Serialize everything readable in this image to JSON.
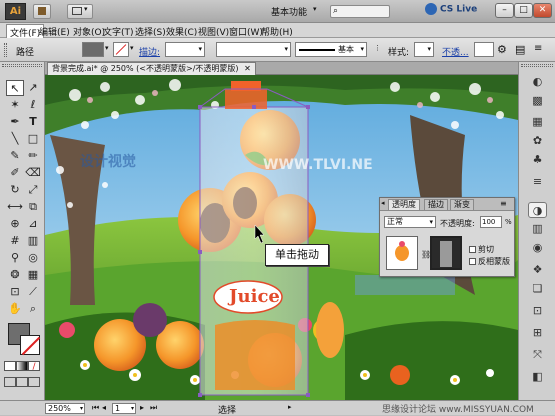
{
  "titlebar": {
    "app_logo": "Ai",
    "workspace": "基本功能",
    "cs_live": "CS Live",
    "win_buttons": [
      "minimize-icon",
      "maximize-icon",
      "close-icon"
    ]
  },
  "menu": [
    "文件(F)",
    "编辑(E)",
    "对象(O)",
    "文字(T)",
    "选择(S)",
    "效果(C)",
    "视图(V)",
    "窗口(W)",
    "帮助(H)"
  ],
  "control": {
    "selection_label": "路径",
    "stroke_label": "描边:",
    "style_preset": "基本",
    "style_label": "样式:",
    "opacity_link": "不透...",
    "opacity_value": ""
  },
  "document_tab": "背景完成.ai* @ 250% (<不透明蒙版>/不透明蒙版)",
  "tooltip": "单击拖动",
  "watermark": {
    "left": "设计视觉",
    "center": "WWW.TLVI.NE"
  },
  "artwork": {
    "juice_label": "Juice"
  },
  "transparency_panel": {
    "tabs": [
      "透明度",
      "描边",
      "渐变"
    ],
    "blend_mode": "正常",
    "opacity_label": "不透明度:",
    "opacity_value": "100",
    "opacity_unit": "%",
    "clip_label": "剪切",
    "invert_label": "反相蒙版"
  },
  "status": {
    "zoom": "250%",
    "page": "1",
    "tool": "选择"
  },
  "site_watermark": "思缘设计论坛 www.MISSYUAN.COM",
  "colors": {
    "accent": "#2d66b4",
    "sky": "#7fbfe8",
    "grass": "#4f9a2c",
    "orange": "#f08a23"
  }
}
